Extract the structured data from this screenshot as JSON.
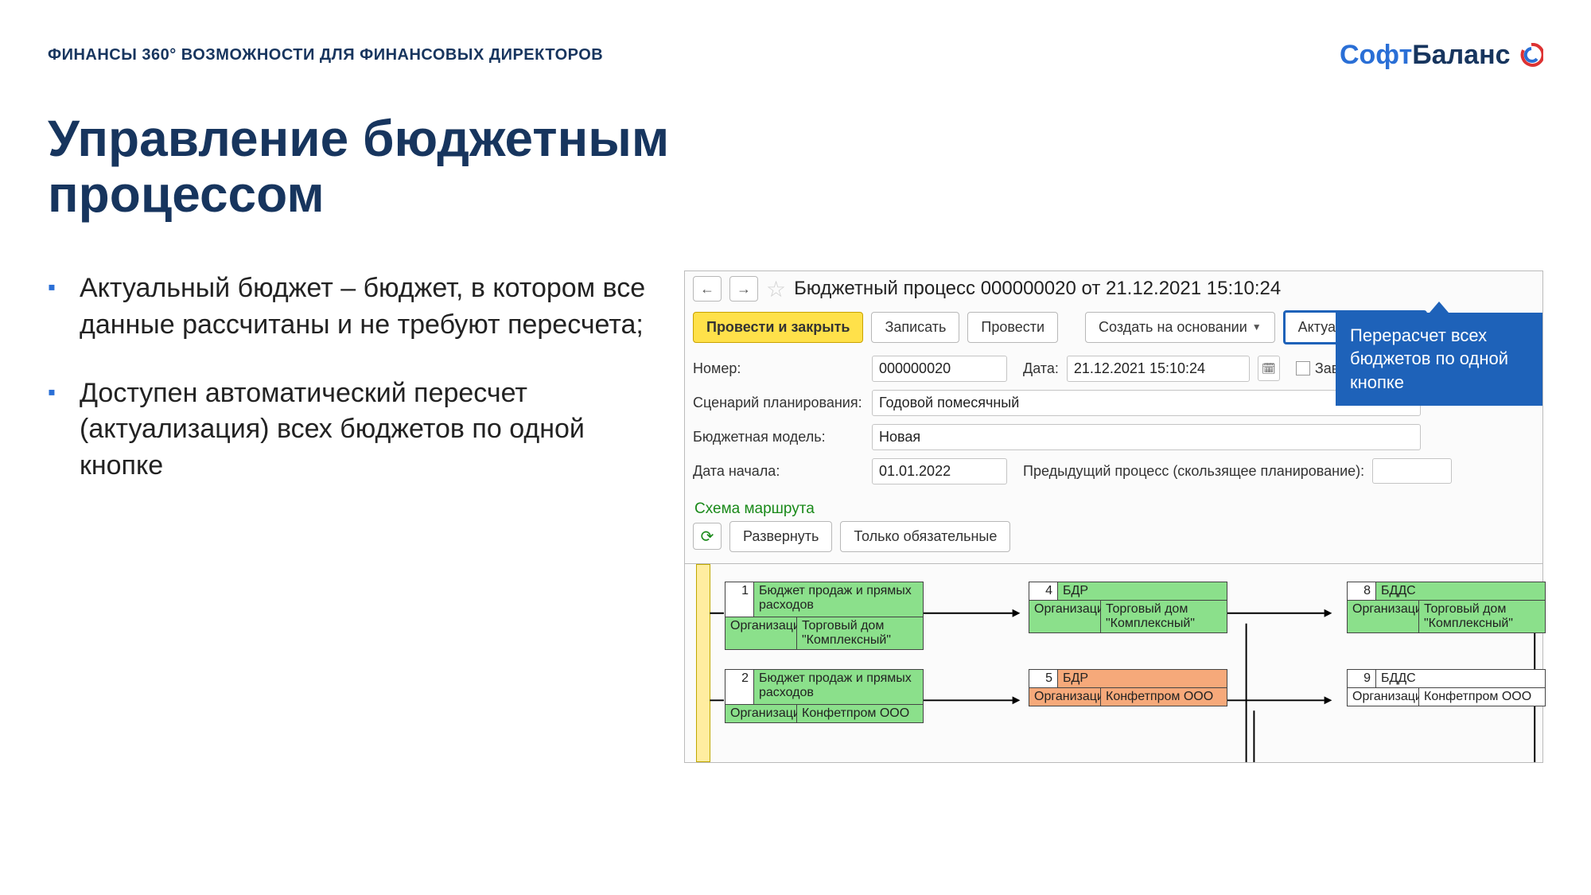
{
  "header": {
    "breadcrumb": "ФИНАНСЫ 360° ВОЗМОЖНОСТИ ДЛЯ ФИНАНСОВЫХ ДИРЕКТОРОВ",
    "logo_soft": "Софт",
    "logo_balance": "Баланс"
  },
  "title": "Управление бюджетным процессом",
  "bullets": [
    "Актуальный бюджет – бюджет, в котором все данные рассчитаны и не требуют пересчета;",
    "Доступен автоматический пересчет (актуализация) всех бюджетов по одной кнопке"
  ],
  "app": {
    "window_title": "Бюджетный процесс 000000020 от 21.12.2021 15:10:24",
    "toolbar": {
      "post_and_close": "Провести и закрыть",
      "save": "Записать",
      "post": "Провести",
      "create_based_on": "Создать на основании",
      "actualize": "Актуализировать"
    },
    "fields": {
      "number_label": "Номер:",
      "number_value": "000000020",
      "date_label": "Дата:",
      "date_value": "21.12.2021 15:10:24",
      "completed_label": "Завершен",
      "scenario_label": "Сценарий планирования:",
      "scenario_value": "Годовой помесячный",
      "model_label": "Бюджетная модель:",
      "model_value": "Новая",
      "start_date_label": "Дата начала:",
      "start_date_value": "01.01.2022",
      "prev_process_label": "Предыдущий процесс (скользящее планирование):"
    },
    "scheme_link": "Схема маршрута",
    "scheme_toolbar": {
      "expand": "Развернуть",
      "mandatory_only": "Только обязательные"
    },
    "diagram": {
      "org_label": "Организация",
      "nodes": [
        {
          "num": "1",
          "title": "Бюджет продаж и прямых расходов",
          "org_value": "Торговый дом \"Комплексный\"",
          "state": "green",
          "tall": true
        },
        {
          "num": "2",
          "title": "Бюджет продаж и прямых расходов",
          "org_value": "Конфетпром ООО",
          "state": "green",
          "tall": true
        },
        {
          "num": "4",
          "title": "БДР",
          "org_value": "Торговый дом \"Комплексный\"",
          "state": "green",
          "tall": false
        },
        {
          "num": "5",
          "title": "БДР",
          "org_value": "Конфетпром ООО",
          "state": "orange",
          "tall": false
        },
        {
          "num": "8",
          "title": "БДДС",
          "org_value": "Торговый дом \"Комплексный\"",
          "state": "green",
          "tall": false
        },
        {
          "num": "9",
          "title": "БДДС",
          "org_value": "Конфетпром ООО",
          "state": "white",
          "tall": false
        }
      ]
    }
  },
  "callout_text": "Перерасчет всех бюджетов по одной кнопке"
}
